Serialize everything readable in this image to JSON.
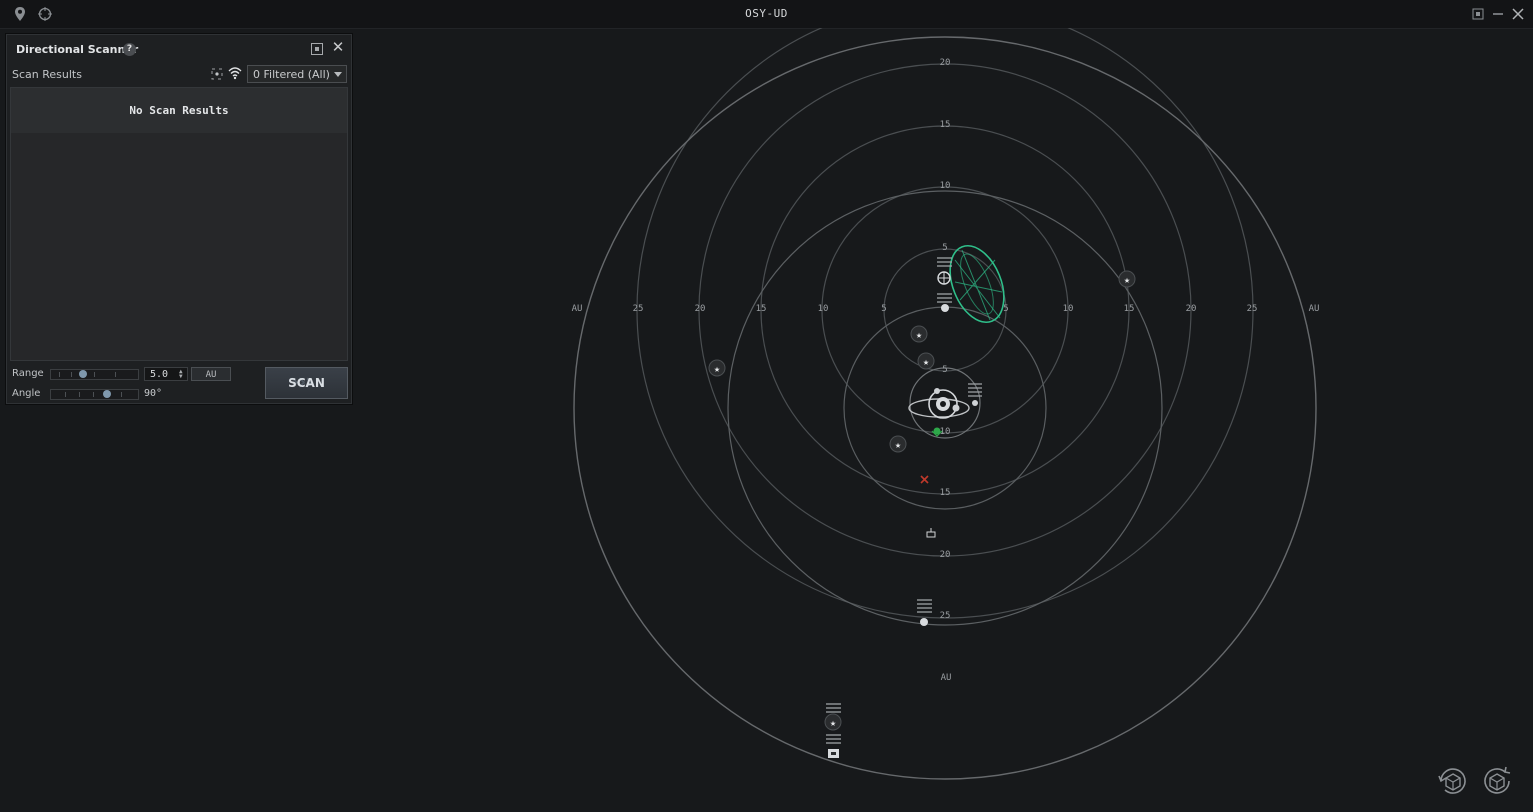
{
  "window": {
    "title": "OSY-UD",
    "left_icons": [
      "location-pin-icon",
      "crosshair-target-icon"
    ],
    "right_icons": [
      "pin-window-icon",
      "minimize-icon",
      "close-icon"
    ]
  },
  "scanner": {
    "title": "Directional Scanner",
    "help_label": "?",
    "results_label": "Scan Results",
    "filter_value": "0 Filtered  (All)",
    "no_results": "No Scan Results",
    "range_label": "Range",
    "range_value": "5.0",
    "range_unit": "AU",
    "range_fraction": 0.35,
    "angle_label": "Angle",
    "angle_value": "90°",
    "angle_fraction": 0.66,
    "scan_button": "SCAN"
  },
  "map": {
    "axis_unit": "AU",
    "tick_labels_upper": [
      "5",
      "10",
      "15",
      "20"
    ],
    "tick_labels_lower": [
      "5",
      "10",
      "15",
      "20",
      "25"
    ],
    "tick_labels_horizontal_left": [
      "25",
      "20",
      "15",
      "10",
      "5"
    ],
    "tick_labels_horizontal_right": [
      "5",
      "10",
      "15",
      "20",
      "25"
    ],
    "colors": {
      "ring": "#4c5053",
      "ring_bright": "#6e7275",
      "label": "#9a9ea2",
      "scan_cone": "#2fbf8a",
      "warning_marker": "#c0392b",
      "beacon": "#2ea84a"
    }
  },
  "view_controls": {
    "icons": [
      "rotate-view-icon",
      "reset-camera-icon"
    ]
  }
}
